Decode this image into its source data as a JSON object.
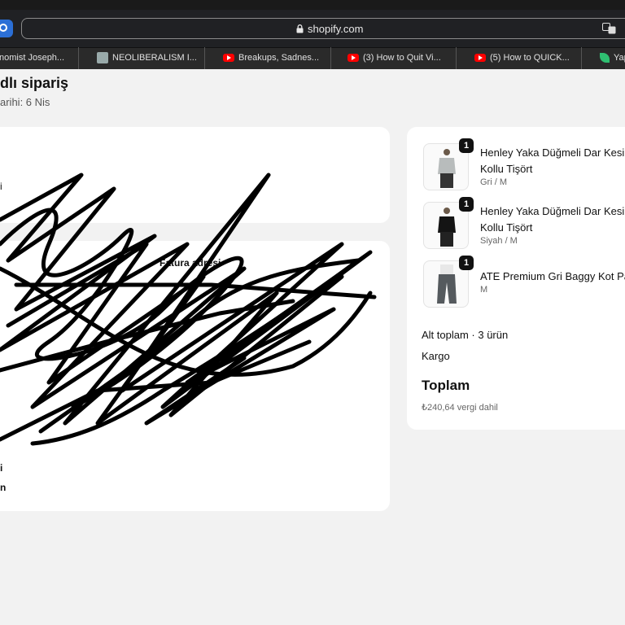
{
  "browser": {
    "url": "shopify.com",
    "tabs": [
      {
        "label": "nomist Joseph...",
        "favicon": "none"
      },
      {
        "label": "NEOLIBERALISM I...",
        "favicon": "thumbnail-icon"
      },
      {
        "label": "Breakups, Sadnes...",
        "favicon": "youtube-icon"
      },
      {
        "label": "(3) How to Quit Vi...",
        "favicon": "youtube-icon"
      },
      {
        "label": "(5) How to QUICK...",
        "favicon": "youtube-icon"
      },
      {
        "label": "Yap",
        "favicon": "leaf-icon"
      }
    ]
  },
  "order": {
    "title": "dlı sipariş",
    "subtitle": "arihi: 6 Nis"
  },
  "address_card": {
    "billing_heading": "Fatura adresi",
    "fragment_left_1": "i",
    "fragment_left_2": "i",
    "fragment_left_3": "n"
  },
  "products": [
    {
      "quantity": "1",
      "name_line1": "Henley Yaka Düğmeli Dar Kesim",
      "name_line2": "Kollu Tişört",
      "variant": "Gri / M",
      "image": "grey-shirt"
    },
    {
      "quantity": "1",
      "name_line1": "Henley Yaka Düğmeli Dar Kesim",
      "name_line2": "Kollu Tişört",
      "variant": "Siyah / M",
      "image": "black-shirt"
    },
    {
      "quantity": "1",
      "name_line1": "ATE Premium Gri Baggy Kot Pa",
      "name_line2": "",
      "variant": "M",
      "image": "baggy-jeans"
    }
  ],
  "summary": {
    "subtotal_label": "Alt toplam · 3 ürün",
    "shipping_label": "Kargo",
    "total_label": "Toplam",
    "tax_note": "₺240,64 vergi dahil"
  },
  "colors": {
    "page_bg": "#f2f2f2",
    "card_bg": "#ffffff",
    "browser_bg": "#202124",
    "badge_bg": "#111111"
  }
}
